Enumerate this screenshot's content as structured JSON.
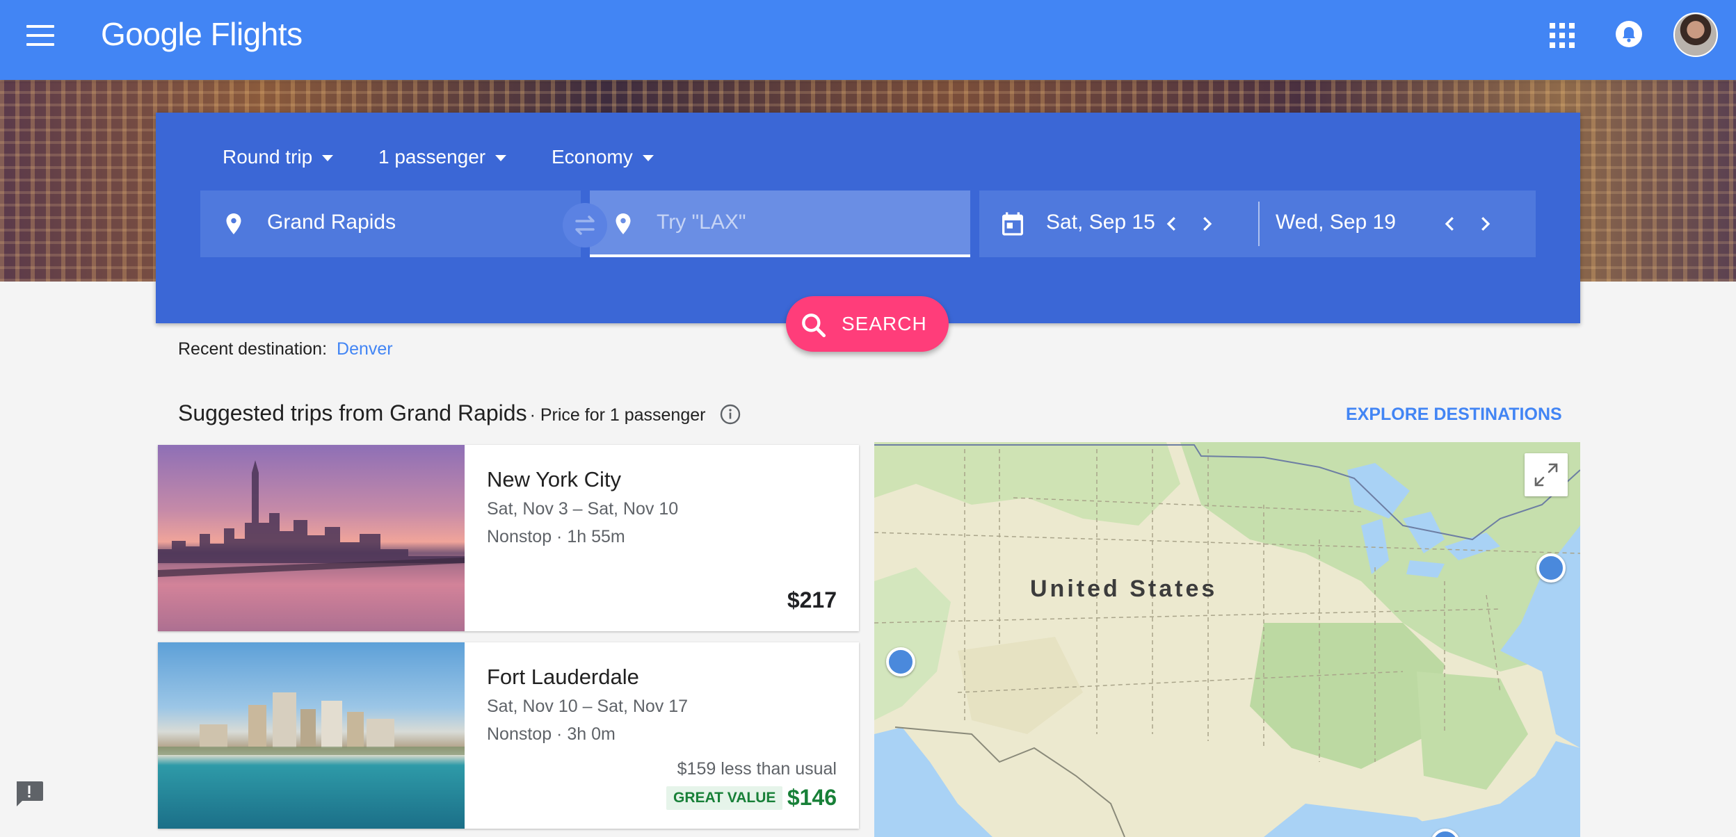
{
  "header": {
    "brand_google": "Google",
    "brand_flights": "Flights"
  },
  "search": {
    "trip_type": "Round trip",
    "passengers": "1 passenger",
    "cabin": "Economy",
    "origin": "Grand Rapids",
    "destination_placeholder": "Try \"LAX\"",
    "depart_date": "Sat, Sep 15",
    "return_date": "Wed, Sep 19",
    "button_label": "SEARCH"
  },
  "recent": {
    "label": "Recent destination:",
    "destination": "Denver"
  },
  "suggested": {
    "title": "Suggested trips from Grand Rapids",
    "subtitle": "· Price for 1 passenger",
    "explore_label": "EXPLORE DESTINATIONS",
    "trips": [
      {
        "city": "New York City",
        "dates": "Sat, Nov 3 – Sat, Nov 10",
        "stops": "Nonstop · 1h 55m",
        "price": "$217"
      },
      {
        "city": "Fort Lauderdale",
        "dates": "Sat, Nov 10 – Sat, Nov 17",
        "stops": "Nonstop · 3h 0m",
        "savings": "$159 less than usual",
        "badge": "GREAT VALUE",
        "price": "$146"
      }
    ]
  },
  "map": {
    "country_label": "United States"
  },
  "colors": {
    "header_blue": "#4285f4",
    "panel_blue": "#3b67d6",
    "search_pink": "#ff3d7a",
    "good_green": "#188038"
  }
}
